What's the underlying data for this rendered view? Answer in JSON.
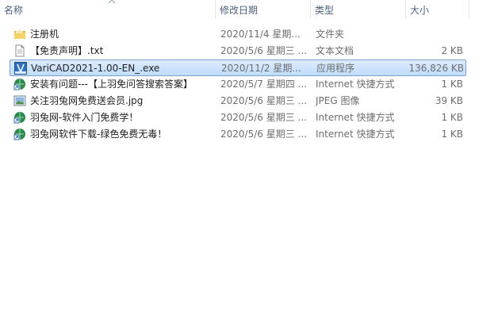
{
  "columns": {
    "name": "名称",
    "date": "修改日期",
    "type": "类型",
    "size": "大小"
  },
  "files": [
    {
      "name": "注册机",
      "date": "2020/11/4 星期...",
      "type": "文件夹",
      "size": "",
      "icon": "folder-icon"
    },
    {
      "name": "【免责声明】.txt",
      "date": "2020/5/6 星期三 ...",
      "type": "文本文档",
      "size": "2 KB",
      "icon": "text-file-icon"
    },
    {
      "name": "VariCAD2021-1.00-EN_.exe",
      "date": "2020/11/2 星期...",
      "type": "应用程序",
      "size": "136,826 KB",
      "icon": "varicad-app-icon"
    },
    {
      "name": "安装有问题---【上羽免问答搜索答案】",
      "date": "2020/5/7 星期四 ...",
      "type": "Internet 快捷方式",
      "size": "1 KB",
      "icon": "internet-shortcut-icon"
    },
    {
      "name": "关注羽兔网免费送会员.jpg",
      "date": "2020/5/6 星期三 ...",
      "type": "JPEG 图像",
      "size": "39 KB",
      "icon": "image-file-icon"
    },
    {
      "name": "羽兔网-软件入门免费学！",
      "date": "2020/5/6 星期三 ...",
      "type": "Internet 快捷方式",
      "size": "1 KB",
      "icon": "internet-shortcut-icon"
    },
    {
      "name": "羽兔网软件下载-绿色免费无毒！",
      "date": "2020/5/6 星期三 ...",
      "type": "Internet 快捷方式",
      "size": "1 KB",
      "icon": "internet-shortcut-icon"
    }
  ],
  "selected_index": 2
}
